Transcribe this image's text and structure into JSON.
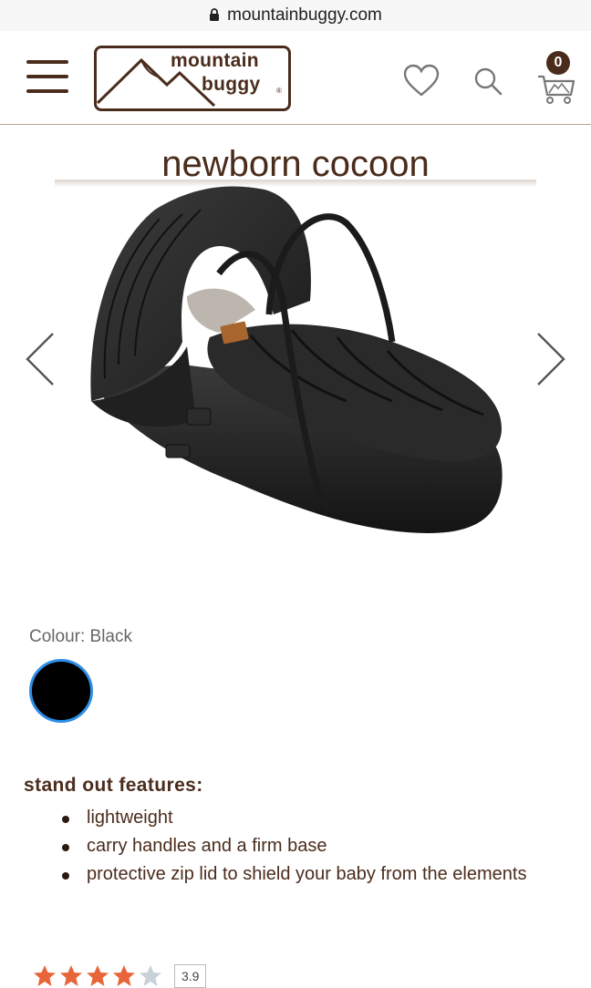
{
  "browser": {
    "url": "mountainbuggy.com"
  },
  "header": {
    "logo_line1": "mountain",
    "logo_line2": "buggy",
    "logo_mark": "®",
    "cart_count": "0"
  },
  "product": {
    "title": "newborn cocoon",
    "image_alt": "black newborn cocoon carrycot with canopy and carry handles",
    "colour_label": "Colour: Black",
    "swatch_color": "#000000",
    "features_heading": "stand out features:",
    "features": [
      "lightweight",
      "carry handles and a firm base",
      "protective zip lid to shield your baby from the elements"
    ],
    "rating": "3.9",
    "rating_stars_filled": 4,
    "rating_stars_total": 5
  },
  "colors": {
    "brand_brown": "#4a2c1c",
    "swatch_ring": "#2e8ee8",
    "star": "#e8653a"
  }
}
